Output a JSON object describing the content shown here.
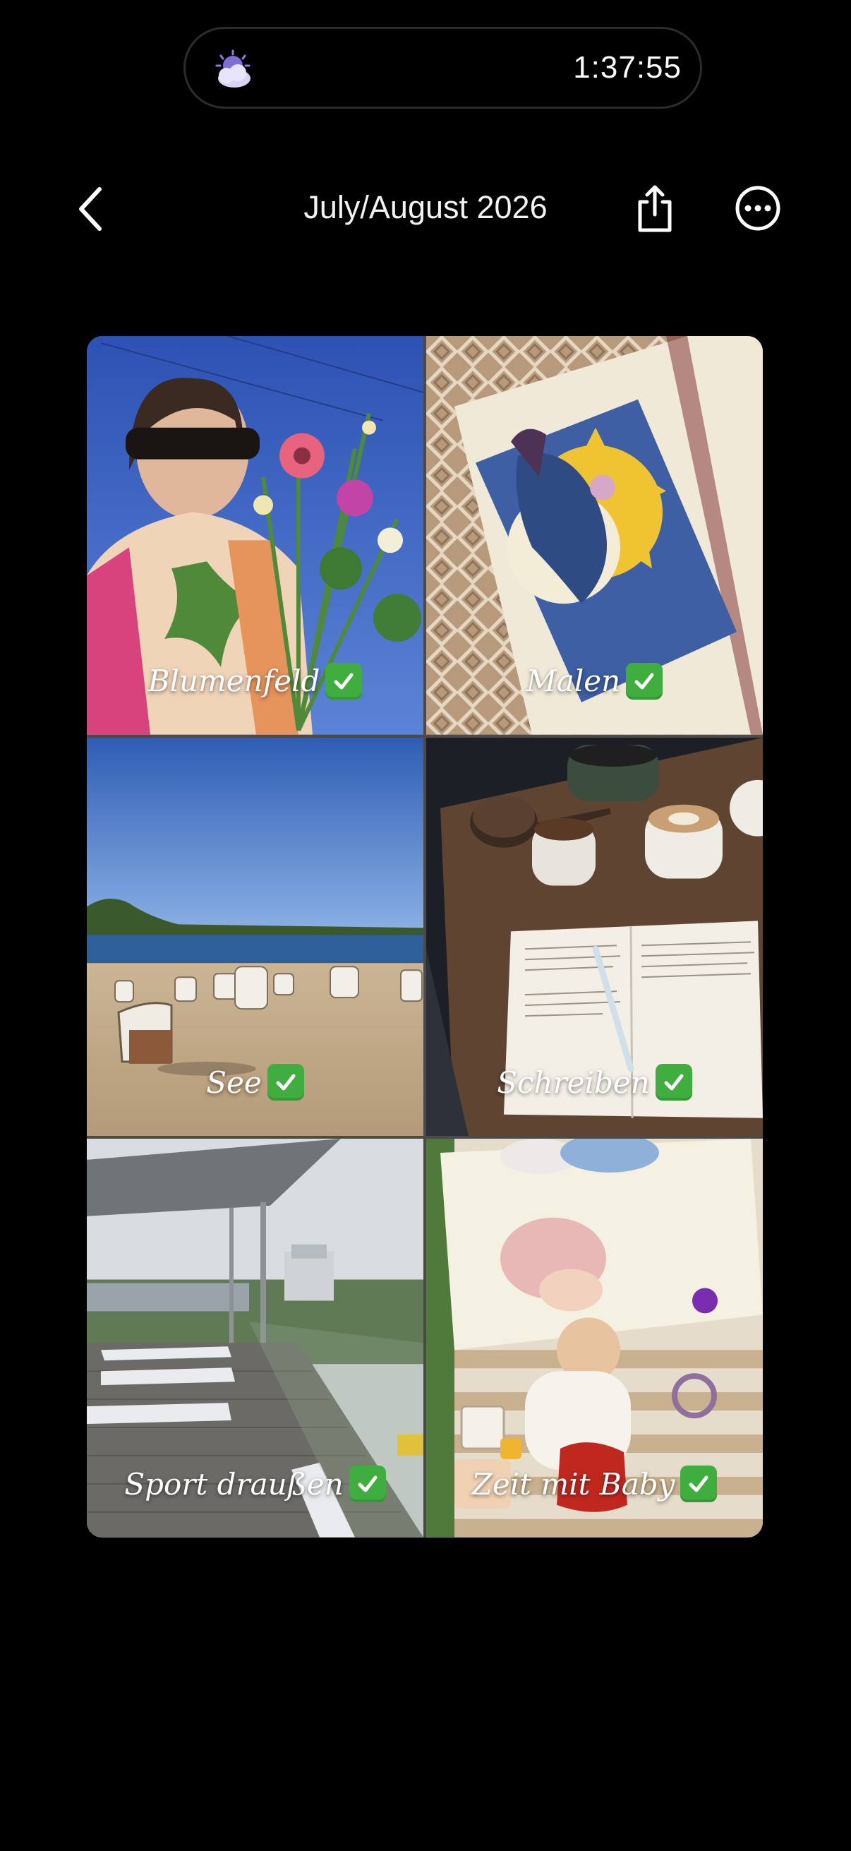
{
  "live_activity": {
    "icon": "weather-moon-cloud-icon",
    "timer": "1:37:55"
  },
  "header": {
    "back_icon": "chevron-left-icon",
    "title": "July/August 2026",
    "share_icon": "share-icon",
    "more_icon": "ellipsis-circle-icon"
  },
  "grid": {
    "items": [
      {
        "label": "Blumenfeld",
        "status_icon": "checkmark-icon"
      },
      {
        "label": "Malen",
        "status_icon": "checkmark-icon"
      },
      {
        "label": "See",
        "status_icon": "checkmark-icon"
      },
      {
        "label": "Schreiben",
        "status_icon": "checkmark-icon"
      },
      {
        "label": "Sport draußen",
        "status_icon": "checkmark-icon"
      },
      {
        "label": "Zeit mit Baby",
        "status_icon": "checkmark-icon"
      }
    ]
  },
  "colors": {
    "background": "#000000",
    "check_green": "#3fae3f"
  }
}
